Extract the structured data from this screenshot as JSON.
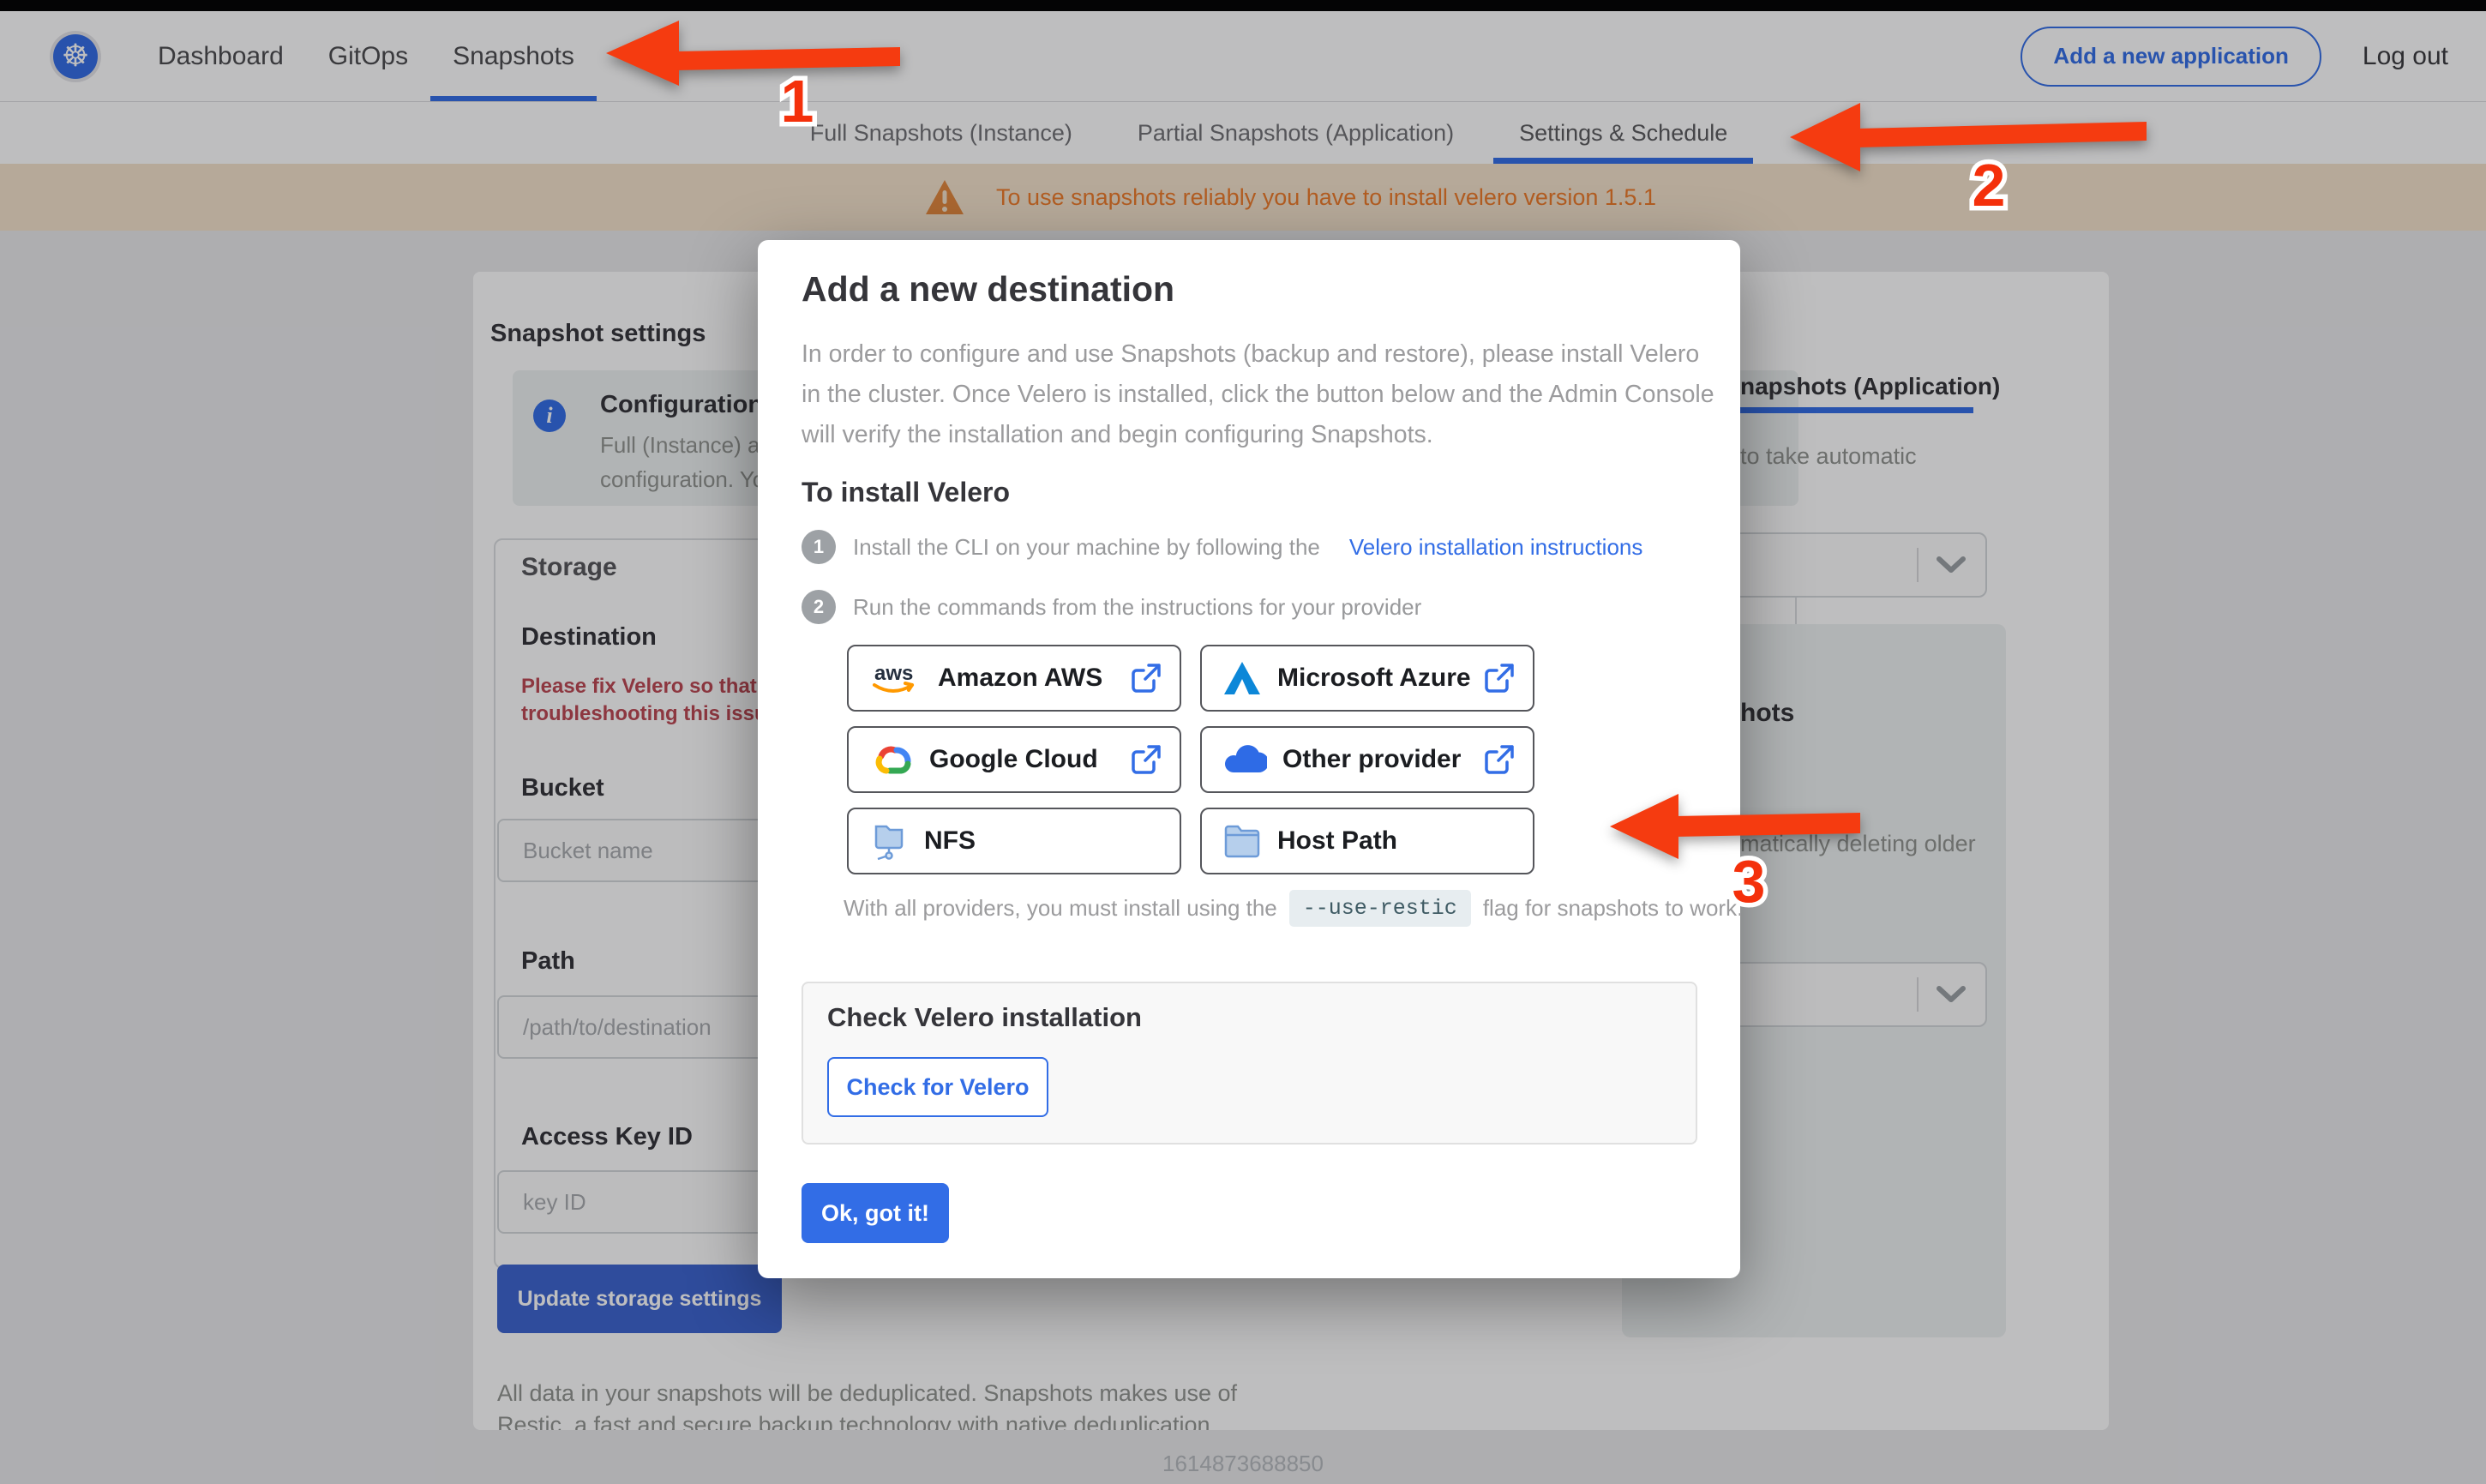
{
  "topnav": {
    "items": [
      {
        "label": "Dashboard"
      },
      {
        "label": "GitOps"
      },
      {
        "label": "Snapshots"
      }
    ],
    "add_app_label": "Add a new application",
    "logout_label": "Log out"
  },
  "subnav": {
    "tabs": [
      {
        "label": "Full Snapshots (Instance)"
      },
      {
        "label": "Partial Snapshots (Application)"
      },
      {
        "label": "Settings & Schedule"
      }
    ]
  },
  "banner": {
    "text": "To use snapshots reliably you have to install velero version 1.5.1"
  },
  "settings_page": {
    "title": "Snapshot settings",
    "info_box": {
      "title_fragment": "Configuration is sh",
      "line1_fragment": "Full (Instance) and Parti",
      "line2_fragment": "configuration. Your stor"
    },
    "storage": {
      "heading": "Storage",
      "destination_label": "Destination",
      "error_line1": "Please fix Velero so that th",
      "error_line2": "troubleshooting this issue",
      "bucket_label": "Bucket",
      "bucket_placeholder": "Bucket name",
      "path_label": "Path",
      "path_placeholder": "/path/to/destination",
      "access_key_label": "Access Key ID",
      "access_key_placeholder": "key ID",
      "update_button": "Update storage settings"
    },
    "dedup_line1": "All data in your snapshots will be deduplicated. Snapshots makes use of",
    "dedup_line2": "Restic, a fast and secure backup technology with native deduplication.",
    "right_fragments": {
      "tab_fragment": "napshots (Application)",
      "schedule_fragment": "to take automatic",
      "heading_fragment": "hots",
      "retention_fragment": "matically deleting older"
    }
  },
  "modal": {
    "title": "Add a new destination",
    "intro": "In order to configure and use Snapshots (backup and restore), please install Velero in the cluster. Once Velero is installed, click the button below and the Admin Console will verify the installation and begin configuring Snapshots.",
    "install_heading": "To install Velero",
    "steps": [
      {
        "number": "1",
        "text": "Install the CLI on your machine by following the",
        "link": "Velero installation instructions"
      },
      {
        "number": "2",
        "text": "Run the commands from the instructions for your provider"
      }
    ],
    "providers": [
      {
        "label": "Amazon AWS"
      },
      {
        "label": "Microsoft Azure"
      },
      {
        "label": "Google Cloud"
      },
      {
        "label": "Other provider"
      },
      {
        "label": "NFS"
      },
      {
        "label": "Host Path"
      }
    ],
    "restic_note_prefix": "With all providers, you must install using the",
    "restic_flag": "--use-restic",
    "restic_note_suffix": "flag for snapshots to work.",
    "check_box": {
      "heading": "Check Velero installation",
      "button": "Check for Velero"
    },
    "ok_button": "Ok, got it!"
  },
  "annotations": {
    "labels": [
      "1",
      "2",
      "3"
    ]
  },
  "footer": {
    "timestamp": "1614873688850"
  },
  "colors": {
    "brand_blue": "#326de6",
    "arrow_red": "#f53b10",
    "error_red": "#bc4752",
    "warning_orange": "#ee7b29"
  }
}
